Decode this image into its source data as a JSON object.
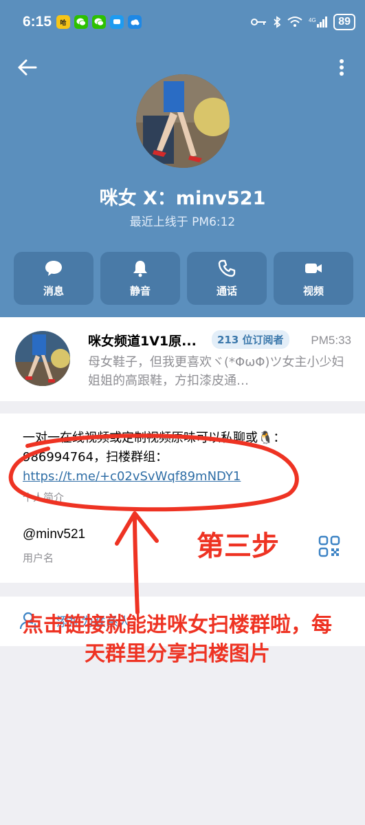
{
  "status_bar": {
    "time": "6:15",
    "battery": "89",
    "app_icons": [
      {
        "name": "app-notification-icon",
        "color": "#f5c518",
        "glyph": "哈"
      },
      {
        "name": "wechat-icon",
        "color": "#2dc100",
        "glyph": "●"
      },
      {
        "name": "wechat-icon",
        "color": "#2dc100",
        "glyph": "●"
      },
      {
        "name": "message-icon",
        "color": "#1e9bf0",
        "glyph": "●"
      },
      {
        "name": "weather-icon",
        "color": "#1e88e5",
        "glyph": "☁"
      }
    ]
  },
  "profile": {
    "name": "咪女 X：minv521",
    "last_seen": "最近上线于 PM6:12"
  },
  "actions": [
    {
      "label": "消息",
      "icon": "message-icon"
    },
    {
      "label": "静音",
      "icon": "bell-icon"
    },
    {
      "label": "通话",
      "icon": "phone-icon"
    },
    {
      "label": "视频",
      "icon": "video-icon"
    }
  ],
  "channel": {
    "title": "咪女频道1V1原...",
    "subscribers": "213 位订阅者",
    "time": "PM5:33",
    "preview": "母女鞋子，但我更喜欢ヾ(*ΦωΦ)ツ女主小少妇姐姐的高跟鞋，方扣漆皮通…"
  },
  "bio": {
    "text": "一对一在线视频或定制视频原味可以私聊或🐧：986994764，扫楼群组：",
    "link": "https://t.me/+c02vSvWqf89mNDY1",
    "caption": "个人简介"
  },
  "username": {
    "value": "@minv521",
    "caption": "用户名"
  },
  "add_contact": {
    "label": "添加为联系人"
  },
  "annotation": {
    "step": "第三步",
    "text": "点击链接就能进咪女扫楼群啦，每天群里分享扫楼图片",
    "color": "#ee3323"
  }
}
